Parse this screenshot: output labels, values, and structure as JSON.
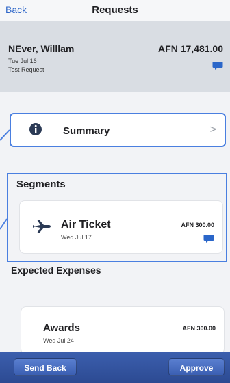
{
  "nav": {
    "back_label": "Back",
    "title": "Requests"
  },
  "header": {
    "name": "NEver, Willlam",
    "amount": "AFN 17,481.00",
    "date": "Tue Jul 16",
    "note": "Test Request",
    "chat_icon": "chat-bubble-icon"
  },
  "summary": {
    "label": "Summary",
    "icon": "info-icon",
    "chevron": ">"
  },
  "segments": {
    "title": "Segments",
    "items": [
      {
        "name": "Air Ticket",
        "date": "Wed Jul 17",
        "amount": "AFN 300.00",
        "icon": "airplane-icon"
      }
    ]
  },
  "expected": {
    "title": "Expected Expenses",
    "items": [
      {
        "name": "Awards",
        "date": "Wed Jul 24",
        "amount": "AFN 300.00"
      }
    ]
  },
  "toolbar": {
    "send_back": "Send Back",
    "approve": "Approve"
  },
  "colors": {
    "accent": "#2f67c9",
    "chat": "#2a66c9",
    "highlight": "#4a7fe0",
    "toolbar": "#3c5fae"
  }
}
